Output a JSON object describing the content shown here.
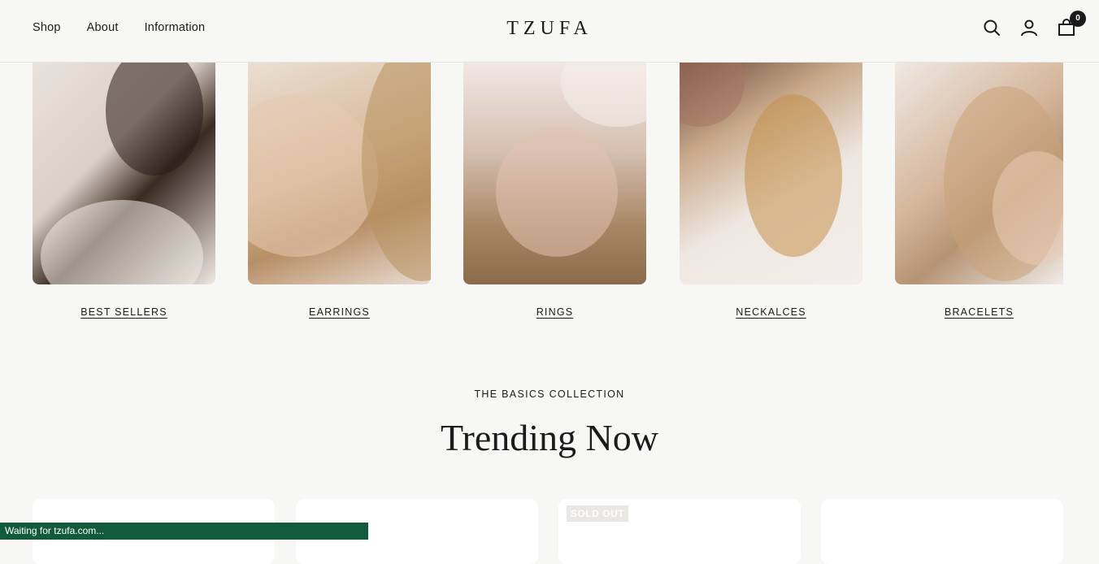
{
  "header": {
    "nav": [
      {
        "label": "Shop"
      },
      {
        "label": "About"
      },
      {
        "label": "Information"
      }
    ],
    "logo": "TZUFA",
    "cart_count": "0",
    "icons": [
      "search-icon",
      "account-icon",
      "cart-icon"
    ]
  },
  "categories": [
    {
      "label": "BEST SELLERS"
    },
    {
      "label": "EARRINGS"
    },
    {
      "label": "RINGS"
    },
    {
      "label": "NECKALCES"
    },
    {
      "label": "BRACELETS"
    }
  ],
  "section": {
    "kicker": "THE BASICS COLLECTION",
    "title": "Trending Now"
  },
  "products": [
    {
      "badge": ""
    },
    {
      "badge": ""
    },
    {
      "badge": "SOLD OUT"
    },
    {
      "badge": ""
    }
  ],
  "status_bar": "Waiting for tzufa.com...",
  "colors": {
    "text": "#1c1b1b",
    "background": "#f7f7f5",
    "status": "#115a3c"
  }
}
